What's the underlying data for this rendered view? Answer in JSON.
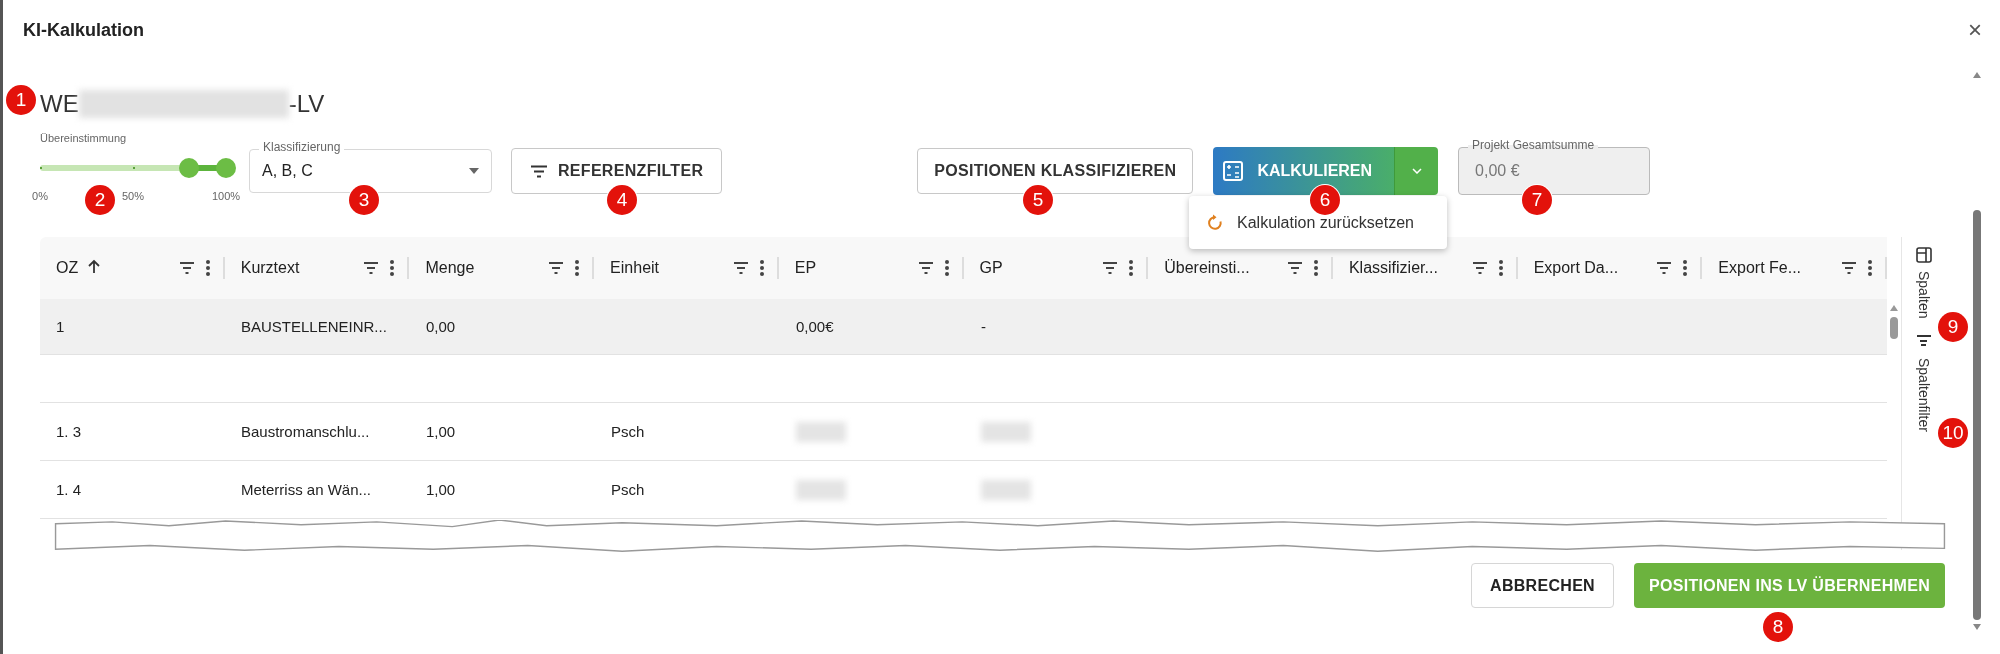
{
  "dialog": {
    "title": "KI-Kalkulation",
    "close": "×"
  },
  "project_title": {
    "start": "WE",
    "end": "-LV",
    "redacted": true
  },
  "match_slider": {
    "label": "Übereinstimmung",
    "thumbs": [
      {
        "level": 0.8
      },
      {
        "level": 1
      }
    ],
    "ticks": [
      "0%",
      "50%",
      "100%"
    ]
  },
  "classification": {
    "label": "Klassifizierung",
    "value": "A, B, C"
  },
  "buttons": {
    "reference_filter": "REFERENZFILTER",
    "classify": "POSITIONEN KLASSIFIZIEREN",
    "calculate": "KALKULIEREN",
    "calculate_menu_expanded": true
  },
  "calculate_menu": [
    {
      "label": "Kalkulation zurücksetzen"
    }
  ],
  "total": {
    "label": "Projekt Gesamtsumme",
    "value": "0,00 €",
    "disabled": true
  },
  "table": {
    "columns": [
      {
        "label": "OZ",
        "sorted": true
      },
      {
        "label": "Kurztext",
        "sorted": false
      },
      {
        "label": "Menge",
        "sorted": false
      },
      {
        "label": "Einheit",
        "sorted": false
      },
      {
        "label": "EP",
        "sorted": false
      },
      {
        "label": "GP",
        "sorted": false
      },
      {
        "label": "Übereinsti...",
        "sorted": false
      },
      {
        "label": "Klassifizier...",
        "sorted": false
      },
      {
        "label": "Export Da...",
        "sorted": false
      },
      {
        "label": "Export Fe...",
        "sorted": false
      }
    ],
    "rows": [
      {
        "kind": "row",
        "selected": true,
        "cells": [
          "1",
          "BAUSTELLENEINR...",
          "0,00",
          "",
          "0,00€",
          "-"
        ]
      },
      {
        "kind": "clipped",
        "selected": false,
        "cells": []
      },
      {
        "kind": "row",
        "selected": false,
        "cells": [
          "1. 3",
          "Baustromanschlu...",
          "1,00",
          "Psch",
          {
            "kind": "redacted"
          },
          {
            "kind": "redacted"
          }
        ]
      },
      {
        "kind": "row",
        "selected": false,
        "cells": [
          "1. 4",
          "Meterriss an Wän...",
          "1,00",
          "Psch",
          {
            "kind": "redacted"
          },
          {
            "kind": "redacted"
          }
        ]
      }
    ],
    "side_panel": [
      {
        "label": "Spalten",
        "kind": "columns"
      },
      {
        "label": "Spaltenfilter",
        "kind": "filter"
      }
    ]
  },
  "footer": {
    "cancel": "ABBRECHEN",
    "apply": "POSITIONEN INS LV ÜBERNEHMEN"
  },
  "annotations": [
    {
      "label": "1"
    },
    {
      "label": "2"
    },
    {
      "label": "3"
    },
    {
      "label": "4"
    },
    {
      "label": "5"
    },
    {
      "label": "6"
    },
    {
      "label": "7"
    },
    {
      "label": "8"
    },
    {
      "label": "9"
    },
    {
      "label": "10"
    }
  ]
}
